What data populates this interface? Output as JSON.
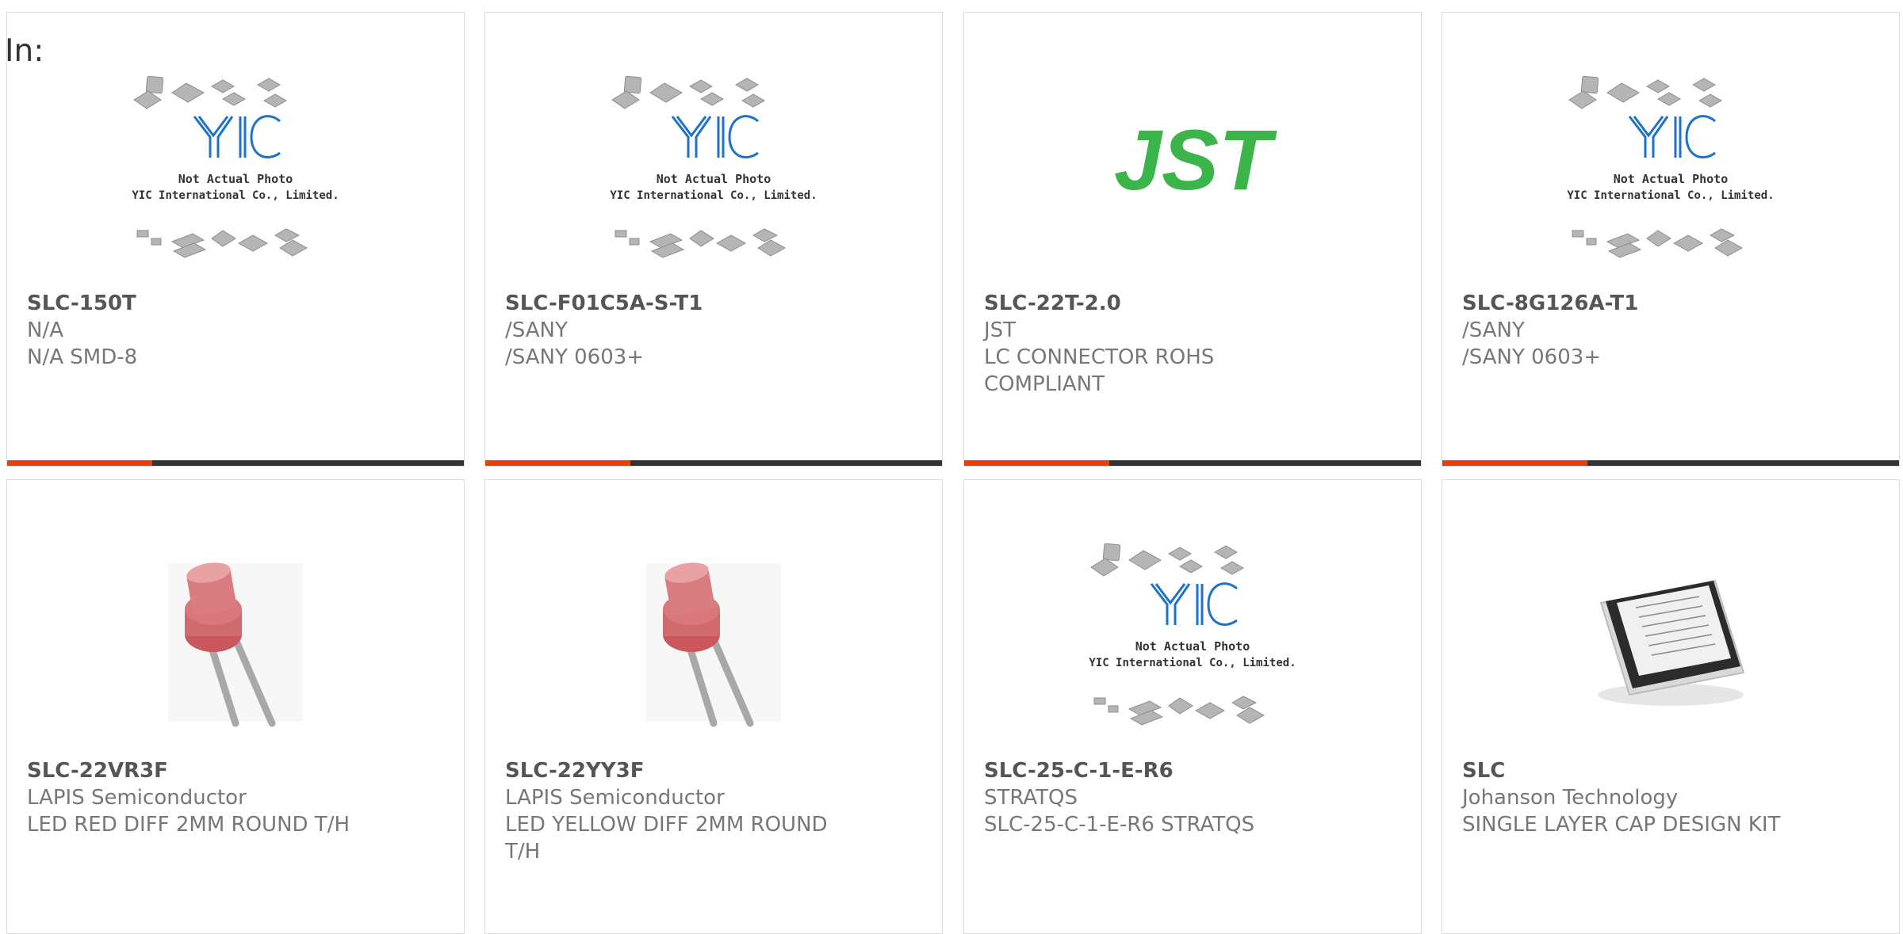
{
  "header": {
    "label": "In:"
  },
  "theme": {
    "accent": "#e8400c",
    "bar": "#333333",
    "jst_green": "#3bb449",
    "yic_blue": "#1e72c7"
  },
  "products": [
    {
      "part_number": "SLC-150T",
      "manufacturer": "N/A",
      "description": "N/A SMD-8",
      "image": "yic-placeholder",
      "photo_caption_1": "Not Actual Photo",
      "photo_caption_2": "YIC International Co., Limited."
    },
    {
      "part_number": "SLC-F01C5A-S-T1",
      "manufacturer": "/SANY",
      "description": "/SANY 0603+",
      "image": "yic-placeholder",
      "photo_caption_1": "Not Actual Photo",
      "photo_caption_2": "YIC International Co., Limited."
    },
    {
      "part_number": "SLC-22T-2.0",
      "manufacturer": "JST",
      "description": "LC CONNECTOR ROHS COMPLIANT",
      "image": "jst-logo",
      "logo_text": "JST"
    },
    {
      "part_number": "SLC-8G126A-T1",
      "manufacturer": "/SANY",
      "description": "/SANY 0603+",
      "image": "yic-placeholder",
      "photo_caption_1": "Not Actual Photo",
      "photo_caption_2": "YIC International Co., Limited."
    },
    {
      "part_number": "SLC-22VR3F",
      "manufacturer": "LAPIS Semiconductor",
      "description": "LED RED DIFF 2MM ROUND T/H",
      "image": "red-led"
    },
    {
      "part_number": "SLC-22YY3F",
      "manufacturer": "LAPIS Semiconductor",
      "description": "LED YELLOW DIFF 2MM ROUND T/H",
      "image": "red-led"
    },
    {
      "part_number": "SLC-25-C-1-E-R6",
      "manufacturer": "STRATQS",
      "description": "SLC-25-C-1-E-R6 STRATQS",
      "image": "yic-placeholder",
      "photo_caption_1": "Not Actual Photo",
      "photo_caption_2": "YIC International Co., Limited."
    },
    {
      "part_number": "SLC",
      "manufacturer": "Johanson Technology",
      "description": "SINGLE LAYER CAP DESIGN KIT",
      "image": "design-kit-box"
    }
  ]
}
